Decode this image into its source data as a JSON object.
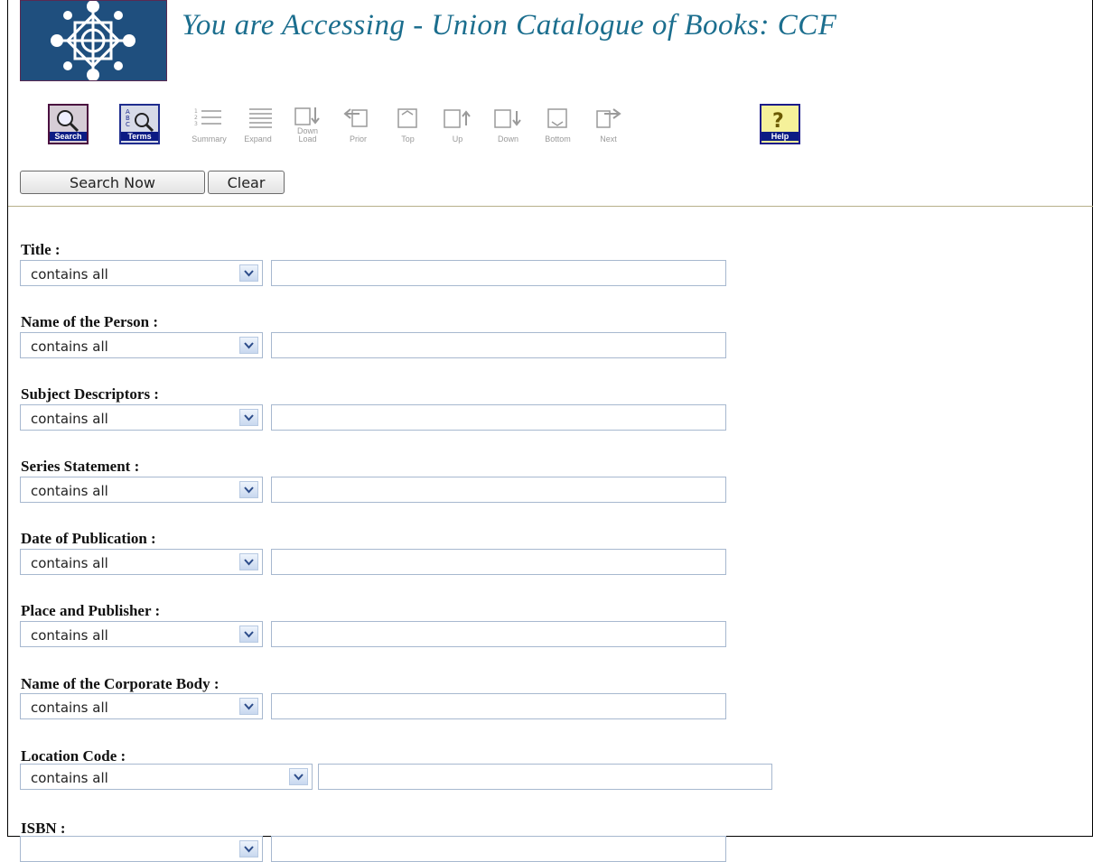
{
  "header": {
    "banner_text": "You are Accessing - Union Catalogue of Books: CCF"
  },
  "toolbar": {
    "buttons": [
      {
        "label": "Search",
        "icon": "magnifier-icon",
        "state": "active"
      },
      {
        "label": "Terms",
        "icon": "terms-list-icon",
        "state": "active"
      },
      {
        "label": "Summary",
        "icon": "summary-list-icon",
        "state": "disabled"
      },
      {
        "label": "Expand",
        "icon": "expand-list-icon",
        "state": "disabled"
      },
      {
        "label": "Down Load",
        "icon": "download-icon",
        "state": "disabled"
      },
      {
        "label": "Prior",
        "icon": "prior-page-icon",
        "state": "disabled"
      },
      {
        "label": "Top",
        "icon": "top-page-icon",
        "state": "disabled"
      },
      {
        "label": "Up",
        "icon": "up-page-icon",
        "state": "disabled"
      },
      {
        "label": "Down",
        "icon": "down-page-icon",
        "state": "disabled"
      },
      {
        "label": "Bottom",
        "icon": "bottom-page-icon",
        "state": "disabled"
      },
      {
        "label": "Next",
        "icon": "next-page-icon",
        "state": "disabled"
      },
      {
        "label": "Help",
        "icon": "help-question-icon",
        "state": "active"
      }
    ]
  },
  "actions": {
    "search_now": "Search Now",
    "clear": "Clear"
  },
  "form": {
    "fields": [
      {
        "label": "Title :",
        "operator": "contains all",
        "value": ""
      },
      {
        "label": "Name of the Person :",
        "operator": "contains all",
        "value": ""
      },
      {
        "label": "Subject Descriptors :",
        "operator": "contains all",
        "value": ""
      },
      {
        "label": "Series Statement :",
        "operator": "contains all",
        "value": ""
      },
      {
        "label": "Date of Publication :",
        "operator": "contains all",
        "value": ""
      },
      {
        "label": "Place and Publisher :",
        "operator": "contains all",
        "value": ""
      },
      {
        "label": "Name of the Corporate Body :",
        "operator": "contains all",
        "value": ""
      },
      {
        "label": "Location Code :",
        "operator": "contains all",
        "value": ""
      },
      {
        "label": "ISBN :",
        "operator": "",
        "value": ""
      }
    ]
  },
  "colors": {
    "banner": "#1b6e8e",
    "toolbar_active_label_bg": "#0c1b84",
    "logo_bg": "#1f4f7e",
    "rule": "#b7b08a"
  }
}
